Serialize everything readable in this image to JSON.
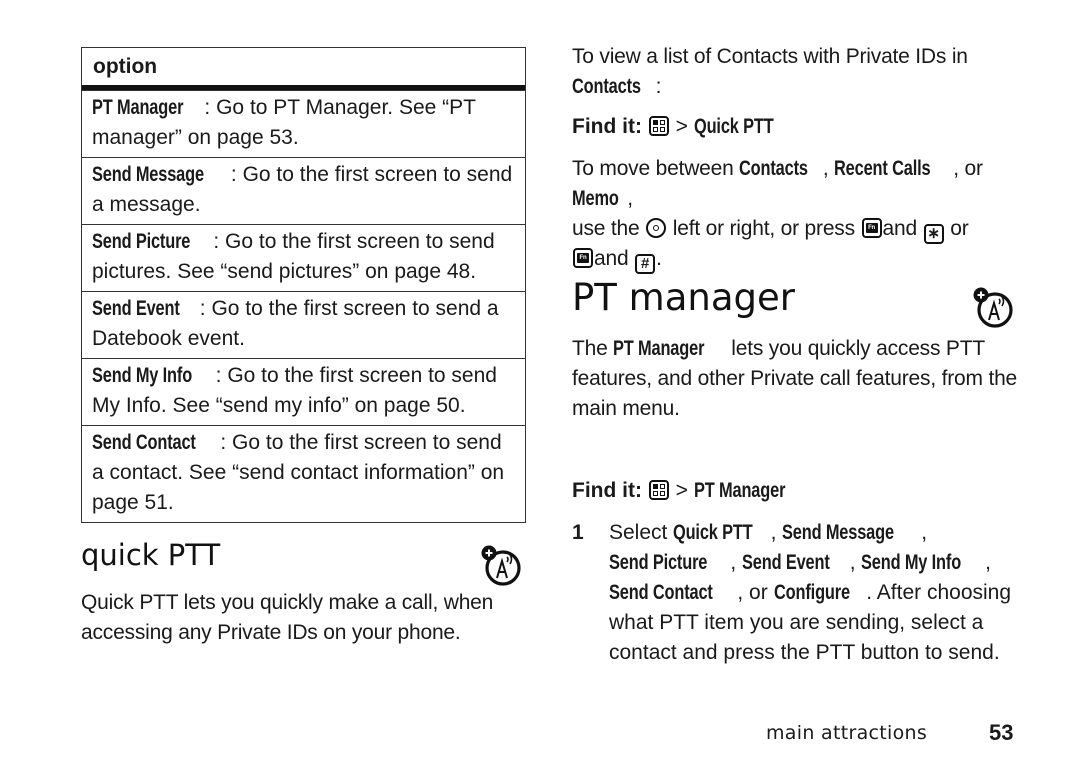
{
  "options_table": {
    "header": "option",
    "rows": [
      {
        "term": "PT Manager",
        "sep": ": ",
        "desc": "Go to PT Manager. See “PT manager” on page 53."
      },
      {
        "term": "Send Message",
        "sep": ": ",
        "desc": "Go to the first screen to send a message."
      },
      {
        "term": "Send Picture",
        "sep": ": ",
        "desc": "Go to the first screen to send pictures. See “send pictures” on page 48."
      },
      {
        "term": "Send Event",
        "sep": ": ",
        "desc": "Go to the first screen to send a Datebook event."
      },
      {
        "term": "Send My Info",
        "sep": ": ",
        "desc": "Go to the first screen to send My Info. See “send my info” on page 50."
      },
      {
        "term": "Send Contact",
        "sep": ": ",
        "desc": "Go to the first screen to send a contact. See “send contact information” on page 51."
      }
    ]
  },
  "quick_ptt": {
    "title": "quick PTT",
    "icon": "ptt-feature-icon",
    "body": "Quick PTT lets you quickly make a call, when accessing any Private IDs on your phone."
  },
  "contacts_view": {
    "intro_a": "To view a list of Contacts with Private IDs in ",
    "intro_term": "Contacts",
    "intro_b": ":",
    "find_it_label": "Find it:",
    "find_it_icon": "menu-key-icon",
    "find_it_sep": " > ",
    "find_it_path": "Quick PTT",
    "move_a": "To move between ",
    "move_t1": "Contacts",
    "move_b": ", ",
    "move_t2": "Recent Calls",
    "move_c": ", or ",
    "move_t3": "Memo",
    "move_d": ",",
    "move_e": "use the ",
    "nav_icon": "nav-key-icon",
    "move_f": " left or right, or press ",
    "fn_icon": "fn-key-icon",
    "move_g": "and ",
    "star_key": "∗",
    "move_h": " or",
    "move_i": "and ",
    "hash_key": "#",
    "move_j": "."
  },
  "pt_manager": {
    "title": "PT manager",
    "icon": "ptt-feature-icon",
    "body_a": "The ",
    "body_term": "PT Manager",
    "body_b": " lets you quickly access PTT features, and other Private call features, from the main menu.",
    "find_it_label": "Find it:",
    "find_it_icon": "menu-key-icon",
    "find_it_sep": " > ",
    "find_it_path": "PT Manager",
    "steps": [
      {
        "num": "1",
        "text_a": "Select ",
        "terms": [
          "Quick PTT",
          "Send Message",
          "Send Picture",
          "Send Event",
          "Send My Info",
          "Send Contact",
          "Configure"
        ],
        "joiners": [
          ", ",
          ", ",
          ", ",
          ", ",
          ", ",
          ", or ",
          "."
        ],
        "text_b": " After choosing what PTT item you are sending, select a contact and press the PTT button to send."
      }
    ]
  },
  "footer": {
    "section": "main attractions",
    "page": "53"
  }
}
